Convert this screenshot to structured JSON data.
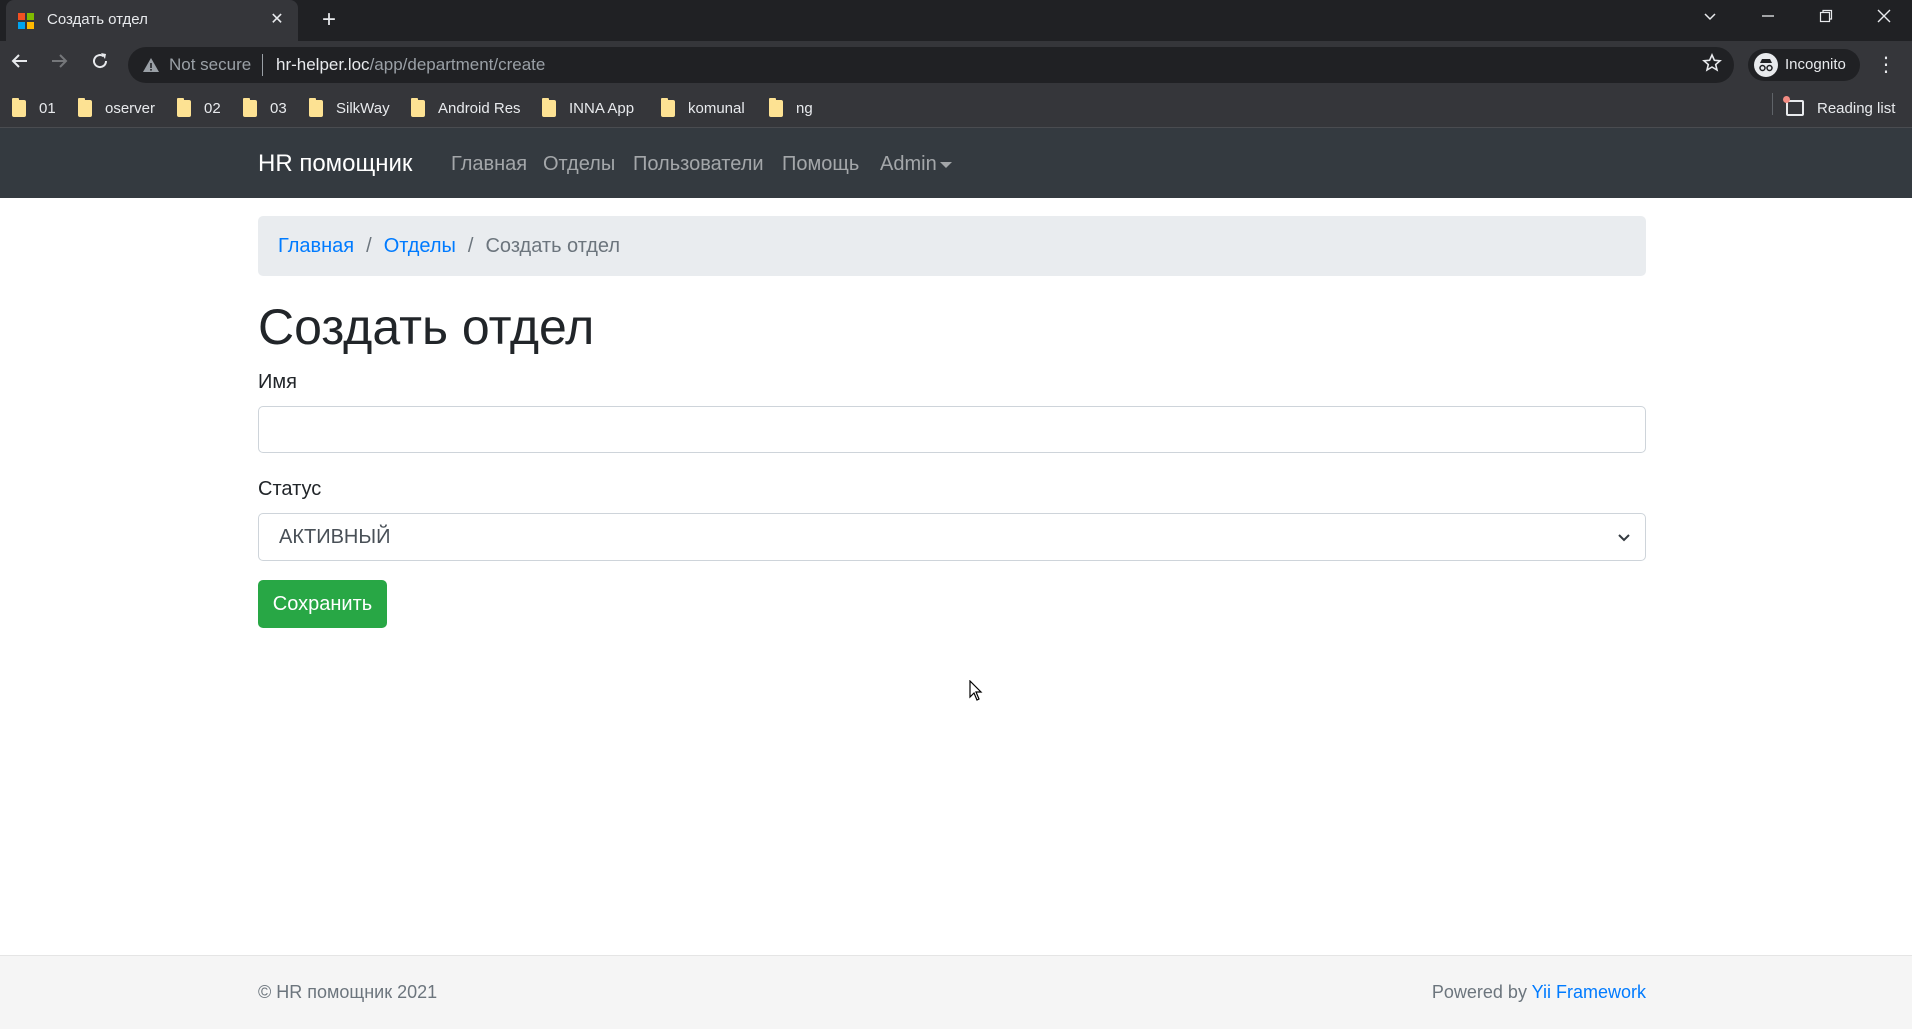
{
  "browser": {
    "tab_title": "Создать отдел",
    "tab_close": "✕",
    "new_tab": "+",
    "security_label": "Not secure",
    "url_host": "hr-helper.loc",
    "url_path": "/app/department/create",
    "incognito_label": "Incognito",
    "bookmarks": [
      "01",
      "oserver",
      "02",
      "03",
      "SilkWay",
      "Android Res",
      "INNA App",
      "komunal",
      "ng"
    ],
    "reading_list_label": "Reading list"
  },
  "navbar": {
    "brand": "HR помощник",
    "links": [
      "Главная",
      "Отделы",
      "Пользователи",
      "Помощь"
    ],
    "admin_label": "Admin"
  },
  "breadcrumb": {
    "home": "Главная",
    "departments": "Отделы",
    "current": "Создать отдел",
    "separator": "/"
  },
  "page": {
    "title": "Создать отдел"
  },
  "form": {
    "name_label": "Имя",
    "name_value": "",
    "status_label": "Статус",
    "status_value": "АКТИВНЫЙ",
    "submit_label": "Сохранить"
  },
  "footer": {
    "copyright": "© HR помощник 2021",
    "powered_prefix": "Powered by",
    "powered_link": "Yii Framework"
  },
  "colors": {
    "navbar_bg": "#343a40",
    "link": "#007bff",
    "success": "#28a745",
    "breadcrumb_bg": "#e9ecef"
  }
}
